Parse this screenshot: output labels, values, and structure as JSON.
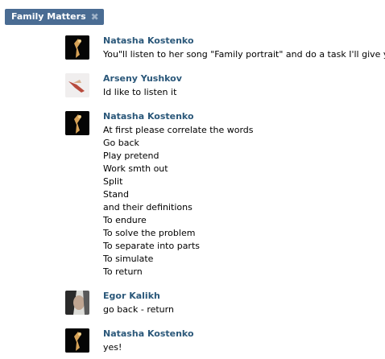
{
  "tag": {
    "label": "Family Matters",
    "close_icon": "close-icon"
  },
  "messages": [
    {
      "author": "Natasha Kostenko",
      "avatar": "natasha",
      "lines": [
        "You\"ll listen to her song \"Family portrait\" and do a task I'll give you"
      ]
    },
    {
      "author": "Arseny Yushkov",
      "avatar": "arseny",
      "lines": [
        "Id like to listen it"
      ]
    },
    {
      "author": "Natasha Kostenko",
      "avatar": "natasha",
      "lines": [
        "At first please correlate the words",
        "Go back",
        "Play pretend",
        "Work smth out",
        "Split",
        "Stand",
        "and their definitions",
        "To endure",
        "To solve the problem",
        "To separate into parts",
        "To simulate",
        "To return"
      ]
    },
    {
      "author": "Egor Kalikh",
      "avatar": "egor",
      "lines": [
        "go back - return"
      ]
    },
    {
      "author": "Natasha Kostenko",
      "avatar": "natasha",
      "lines": [
        "yes!"
      ]
    }
  ],
  "colors": {
    "tag_bg": "#4a6c93",
    "name": "#2b587a"
  }
}
